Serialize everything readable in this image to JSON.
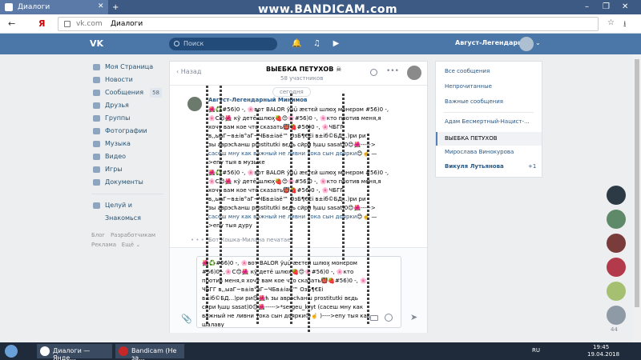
{
  "browser": {
    "tab_title": "Диалоги",
    "tab_close": "✕",
    "new_tab": "+",
    "watermark": "www.BANDICAM.com",
    "url_host": "vk.com",
    "url_title": "Диалоги",
    "ya": "Я",
    "win_min": "–",
    "win_restore": "❐",
    "win_close": "✕"
  },
  "vk_header": {
    "logo": "VK",
    "search_placeholder": "Поиск",
    "username": "Август-Легендарный"
  },
  "left_menu": {
    "items": [
      {
        "label": "Моя Страница"
      },
      {
        "label": "Новости"
      },
      {
        "label": "Сообщения",
        "count": "58"
      },
      {
        "label": "Друзья"
      },
      {
        "label": "Группы"
      },
      {
        "label": "Фотографии"
      },
      {
        "label": "Музыка"
      },
      {
        "label": "Видео"
      },
      {
        "label": "Игры"
      },
      {
        "label": "Документы"
      }
    ],
    "extra": "Целуй и Знакомься",
    "footer": {
      "blog": "Блог",
      "developers": "Разработчикам",
      "ads": "Реклама",
      "more": "Ещё ⌄"
    }
  },
  "chat": {
    "back": "Назад",
    "title": "ВЫЕБКА ПЕТУХОВ ☠",
    "members": "58 участников",
    "date": "сегодня",
    "author": "Август-Легендарный Минимов",
    "message1": "🌺♻️#56)0 -, 🌸вот BALOR ўџџ̈ ӕєтєй шлюӽ монєром #56)0 -,\n🌸С😊🌺 кў детё шлюӽ🍓😊🌸#56)0 -, 🌸кто против меня,я\nхочу вам кое что сказать👹🍓#56)0 -, 🌸ЧБГГ\nв,,ыаГ~в±ів°аГ~ЧБв±іаё™ ОзБ¶€Еі в±іб©БД...)ри ри\nзы аврэсћанш prostitutki вєдь сӣри ђшџ sasat)0😊🌺----->\n",
    "message1_link": "сасеш мну как важный не ливни тока сын доярки",
    "message1_tail": "😊☝️ —\n>епу тыя в музыке",
    "message2": "🌺♻️#56)0 -, 🌸вот BALOR ўџџ̈ ӕєтєй шлюӽ монєром #56)0 -,\n🌸С😊🌺 кў детё шлюӽ🍓😊🌸#56)0 -, 🌸кто против меня,я\nхочу вам кое что сказать👹🍓#56)0 -, 🌸ЧБГГ\nв,,ыаГ~в±ів°аГ~ЧБв±іаё™ ОзБ¶€Еі в±іб©БД...)ри ри\nзы аврэсћанш prostitutki вєдь сӣри ђшџ sasat)0😊🌺----->\n",
    "message2_link": "сасеш мну как важный не ливни тока сын доярки",
    "message2_tail": "😊☝️ —\n>епу тыя дуру",
    "typing": "Бот Кошка-Милана печатает",
    "typing_dots": "• • •",
    "composer_text": "🌺♻️#56)0 -, 🌸вот BALOR ўџџ̈ ӕєтєй шлюӽ монєром\n#56)0 -,🌸С😊🌺 кў детё шлюӽ🍓😊🌸#56)0 -, 🌸кто\nпротив меня,я хочу вам кое что сказать👹🍓#56)0 -, 🌸\nЧБГГ в,,ыаГ~в±ів°аГ~ЧБв±іаё™ ОзБ¶€Еі\nв±іб©БД...)ри ри😊🌺ћ зы аврэсћанш prostitutki вєдь\nсӣри ђшџ sasat)0😊🌺----->*sergeu_kryt (сасеш мну как\nважный не ливни тока сын доярки😊☝️ )---->епу тыя как\nшалаву"
  },
  "right_panel": {
    "all": "Все сообщения",
    "unread": "Непрочитанные",
    "important": "Важные сообщения",
    "dialog1": "Адам Бесмертный-Нацист-...",
    "dialog_active": "ВЫЕБКА ПЕТУХОВ",
    "dialog3": "Мирослава Винокурова",
    "dialog4": "Викуля Лутьянова",
    "dialog4_badge": "+1"
  },
  "contacts": {
    "count": "44"
  },
  "taskbar": {
    "task1": "Диалоги — Янде...",
    "task2": "Bandicam (Не за...",
    "lang": "RU",
    "time": "19:45",
    "date": "19.04.2018"
  },
  "colors": {
    "vk_blue": "#4a76a8",
    "link": "#2a5885",
    "background": "#edeef0"
  }
}
